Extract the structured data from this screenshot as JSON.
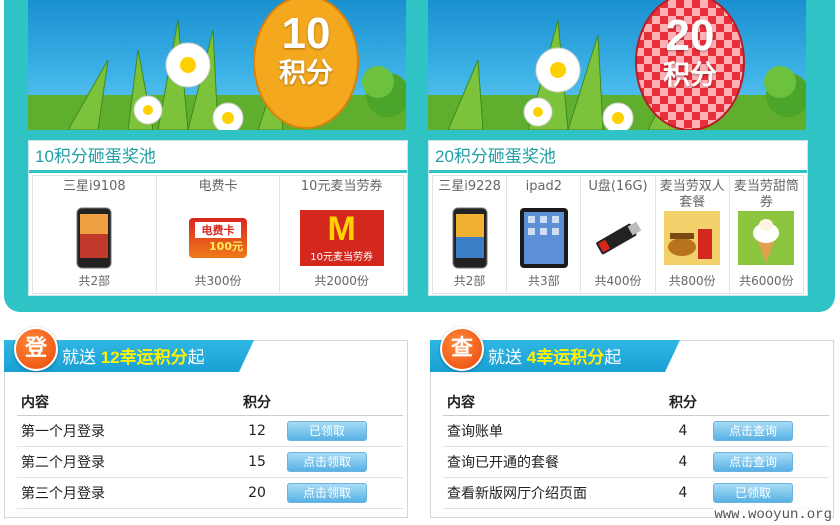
{
  "banners": {
    "left": {
      "egg_number": "10",
      "egg_unit": "积分",
      "egg_color": "#f4a81d"
    },
    "right": {
      "egg_number": "20",
      "egg_unit": "积分",
      "egg_color": "#e8303a"
    }
  },
  "pools": {
    "left": {
      "title": "10积分砸蛋奖池",
      "prizes": [
        {
          "name": "三星i9108",
          "count": "共2部",
          "icon": "phone-icon"
        },
        {
          "name": "电费卡",
          "count": "共300份",
          "icon": "electricity-card-icon",
          "card_text": "电费卡",
          "card_value": "100元"
        },
        {
          "name": "10元麦当劳券",
          "count": "共2000份",
          "icon": "mcdonalds-voucher-icon",
          "card_text": "10元麦当劳券"
        }
      ]
    },
    "right": {
      "title": "20积分砸蛋奖池",
      "prizes": [
        {
          "name": "三星i9228",
          "count": "共2部",
          "icon": "phone-icon"
        },
        {
          "name": "ipad2",
          "count": "共3部",
          "icon": "tablet-icon"
        },
        {
          "name": "U盘(16G)",
          "count": "共400份",
          "icon": "usb-drive-icon"
        },
        {
          "name": "麦当劳双人套餐",
          "count": "共800份",
          "icon": "meal-icon"
        },
        {
          "name": "麦当劳甜筒券",
          "count": "共6000份",
          "icon": "icecream-icon"
        }
      ]
    }
  },
  "sections": {
    "login": {
      "badge": "登",
      "title_prefix": "就送",
      "title_highlight": "12幸运积分",
      "title_suffix": "起",
      "headers": {
        "name": "内容",
        "points": "积分"
      },
      "rows": [
        {
          "name": "第一个月登录",
          "points": "12",
          "action": "已领取"
        },
        {
          "name": "第二个月登录",
          "points": "15",
          "action": "点击领取"
        },
        {
          "name": "第三个月登录",
          "points": "20",
          "action": "点击领取"
        }
      ]
    },
    "query": {
      "badge": "查",
      "title_prefix": "就送",
      "title_highlight": "4幸运积分",
      "title_suffix": "起",
      "headers": {
        "name": "内容",
        "points": "积分"
      },
      "rows": [
        {
          "name": "查询账单",
          "points": "4",
          "action": "点击查询"
        },
        {
          "name": "查询已开通的套餐",
          "points": "4",
          "action": "点击查询"
        },
        {
          "name": "查看新版网厅介绍页面",
          "points": "4",
          "action": "已领取"
        }
      ]
    }
  },
  "watermark": "www.wooyun.org",
  "colors": {
    "teal": "#2fc3c6",
    "pool_title": "#1e9fa5",
    "header_blue": "#1a9fd3",
    "badge_orange": "#e9480d",
    "highlight_yellow": "#fff200"
  }
}
